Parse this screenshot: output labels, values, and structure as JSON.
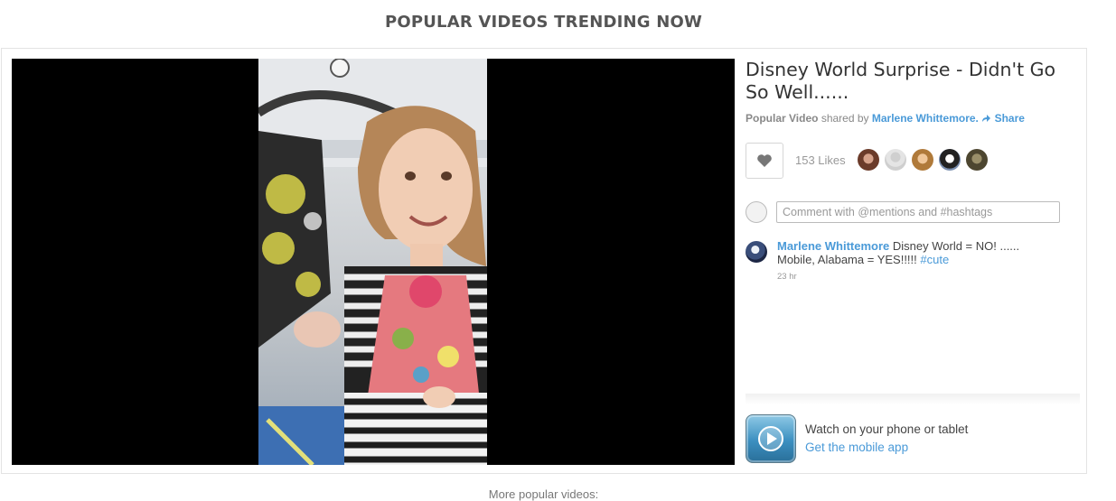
{
  "page": {
    "heading": "POPULAR VIDEOS TRENDING NOW",
    "more_label": "More popular videos:"
  },
  "video": {
    "title": "Disney World Surprise - Didn't Go So Well......",
    "category": "Popular Video",
    "shared_by_text": "shared by",
    "author": "Marlene Whittemore.",
    "share_label": "Share",
    "likes_text": "153 Likes",
    "liker_avatar_count": 5
  },
  "comments": {
    "placeholder": "Comment with @mentions and #hashtags",
    "items": [
      {
        "author": "Marlene Whittemore",
        "text": "Disney World = NO! ...... Mobile, Alabama = YES!!!!!",
        "hashtag": "#cute",
        "time": "23 hr"
      }
    ]
  },
  "app_promo": {
    "line1": "Watch on your phone or tablet",
    "line2": "Get the mobile app"
  },
  "colors": {
    "link": "#4a9ad8",
    "heading": "#555555",
    "player_bg": "#000000"
  },
  "icons": [
    "heart-icon",
    "share-arrow-icon",
    "play-icon"
  ]
}
